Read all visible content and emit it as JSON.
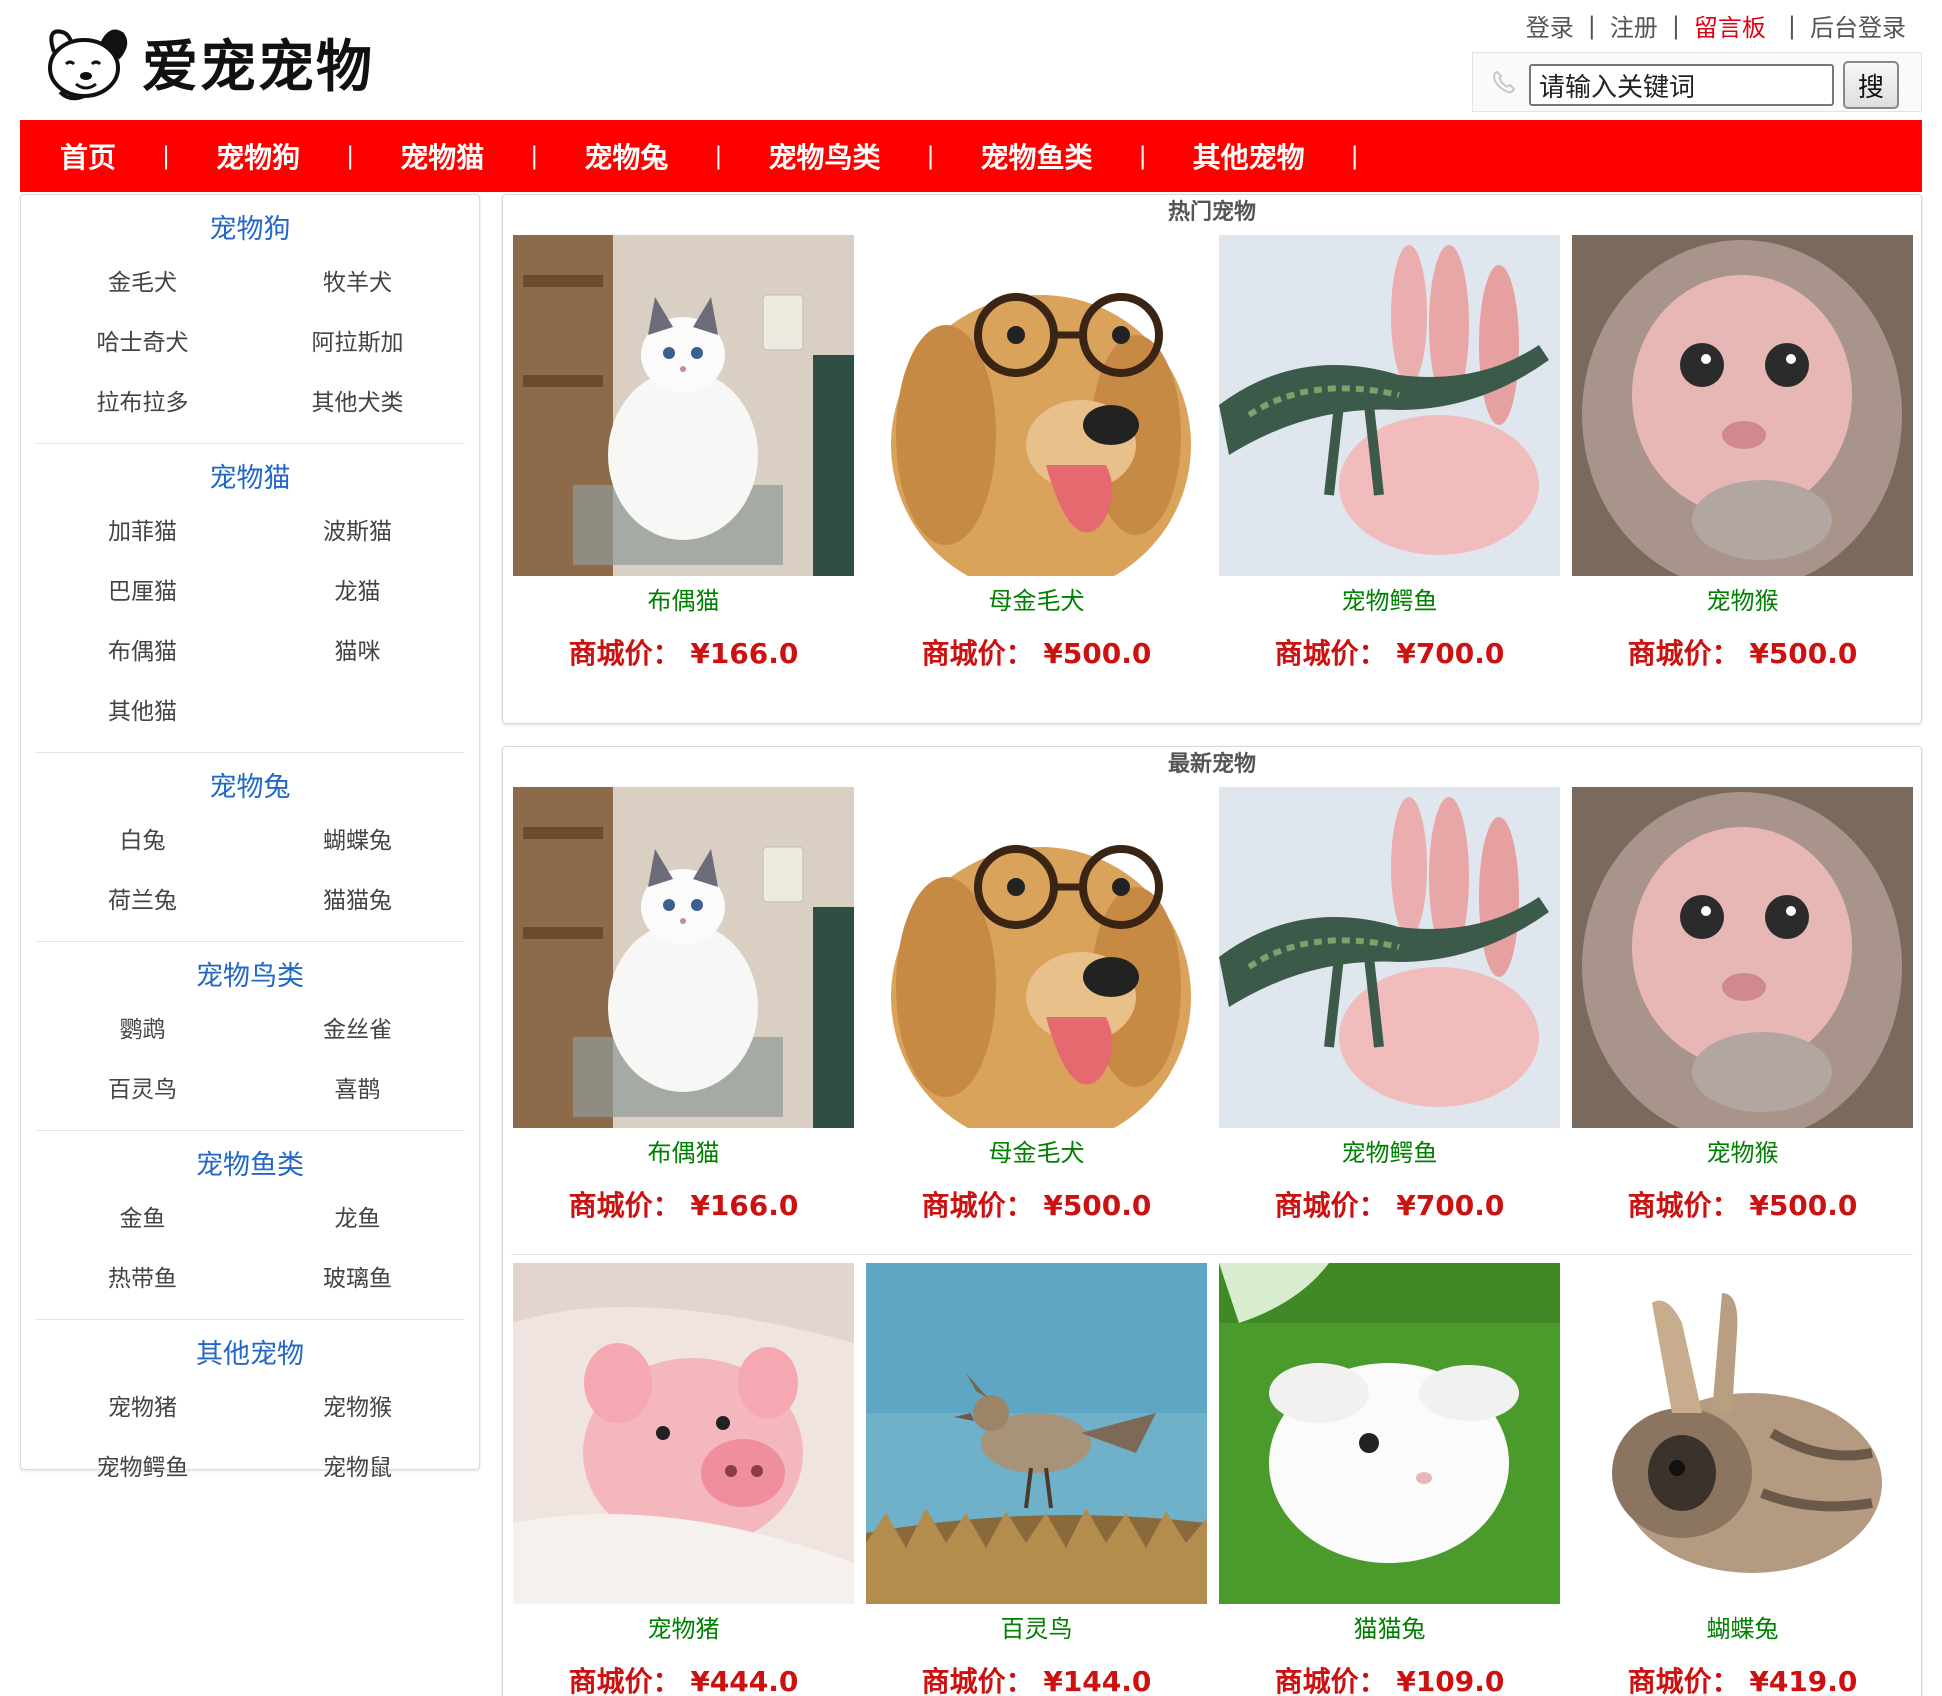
{
  "site": {
    "logo_text": "爱宠宠物"
  },
  "toplinks": {
    "login": "登录",
    "register": "注册",
    "guestbook": "留言板",
    "admin": "后台登录",
    "sep": "|"
  },
  "search": {
    "placeholder": "请输入关键词",
    "value": "请输入关键词",
    "button": "搜"
  },
  "nav": {
    "items": [
      "首页",
      "宠物狗",
      "宠物猫",
      "宠物兔",
      "宠物鸟类",
      "宠物鱼类",
      "其他宠物"
    ],
    "sep": "|"
  },
  "sidebar": {
    "categories": [
      {
        "title": "宠物狗",
        "items": [
          "金毛犬",
          "牧羊犬",
          "哈士奇犬",
          "阿拉斯加",
          "拉布拉多",
          "其他犬类"
        ]
      },
      {
        "title": "宠物猫",
        "items": [
          "加菲猫",
          "波斯猫",
          "巴厘猫",
          "龙猫",
          "布偶猫",
          "猫咪",
          "其他猫"
        ]
      },
      {
        "title": "宠物兔",
        "items": [
          "白兔",
          "蝴蝶兔",
          "荷兰兔",
          "猫猫兔"
        ]
      },
      {
        "title": "宠物鸟类",
        "items": [
          "鹦鹉",
          "金丝雀",
          "百灵鸟",
          "喜鹊"
        ]
      },
      {
        "title": "宠物鱼类",
        "items": [
          "金鱼",
          "龙鱼",
          "热带鱼",
          "玻璃鱼"
        ]
      },
      {
        "title": "其他宠物",
        "items": [
          "宠物猪",
          "宠物猴",
          "宠物鳄鱼",
          "宠物鼠"
        ]
      }
    ]
  },
  "hot": {
    "title": "热门宠物",
    "products": [
      {
        "name": "布偶猫",
        "price": "商城价：  ¥166.0",
        "image": "cat-photo"
      },
      {
        "name": "母金毛犬",
        "price": "商城价：  ¥500.0",
        "image": "dog-photo"
      },
      {
        "name": "宠物鳄鱼",
        "price": "商城价：  ¥700.0",
        "image": "crocodile-photo"
      },
      {
        "name": "宠物猴",
        "price": "商城价：  ¥500.0",
        "image": "monkey-photo"
      }
    ]
  },
  "latest": {
    "title": "最新宠物",
    "products": [
      {
        "name": "布偶猫",
        "price": "商城价：  ¥166.0",
        "image": "cat-photo"
      },
      {
        "name": "母金毛犬",
        "price": "商城价：  ¥500.0",
        "image": "dog-photo"
      },
      {
        "name": "宠物鳄鱼",
        "price": "商城价：  ¥700.0",
        "image": "crocodile-photo"
      },
      {
        "name": "宠物猴",
        "price": "商城价：  ¥500.0",
        "image": "monkey-photo"
      },
      {
        "name": "宠物猪",
        "price": "商城价：  ¥444.0",
        "image": "pig-photo"
      },
      {
        "name": "百灵鸟",
        "price": "商城价：  ¥144.0",
        "image": "lark-photo"
      },
      {
        "name": "猫猫兔",
        "price": "商城价：  ¥109.0",
        "image": "white-rabbit-photo"
      },
      {
        "name": "蝴蝶兔",
        "price": "商城价：  ¥419.0",
        "image": "butterfly-rabbit-photo"
      }
    ]
  },
  "colors": {
    "nav_bg": "#ff0000",
    "category_title": "#2368c6",
    "product_name": "#008000",
    "price": "#cc1111",
    "highlight_link": "#e60012"
  }
}
